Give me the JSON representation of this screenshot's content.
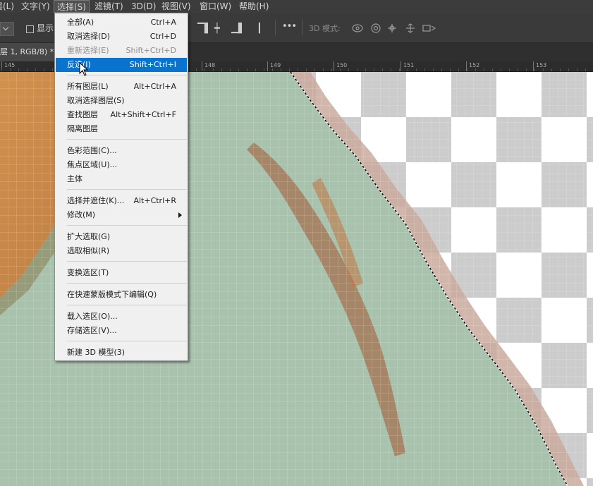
{
  "menubar": {
    "items": [
      {
        "label": "层(L)"
      },
      {
        "label": "文字(Y)"
      },
      {
        "label": "选择(S)"
      },
      {
        "label": "滤镜(T)"
      },
      {
        "label": "3D(D)"
      },
      {
        "label": "视图(V)"
      },
      {
        "label": "窗口(W)"
      },
      {
        "label": "帮助(H)"
      }
    ]
  },
  "options": {
    "show_label": "显示",
    "mode_3d_label": "3D 模式:",
    "more_label": "•••"
  },
  "document": {
    "tab_title": "层 1, RGB/8) *"
  },
  "ruler": {
    "labels": [
      "145",
      "148",
      "149",
      "150",
      "151",
      "152",
      "153"
    ]
  },
  "select_menu": {
    "items": [
      {
        "label": "全部(A)",
        "shortcut": "Ctrl+A",
        "state": "normal"
      },
      {
        "label": "取消选择(D)",
        "shortcut": "Ctrl+D",
        "state": "normal"
      },
      {
        "label": "重新选择(E)",
        "shortcut": "Shift+Ctrl+D",
        "state": "disabled"
      },
      {
        "label": "反选(I)",
        "shortcut": "Shift+Ctrl+I",
        "state": "highlighted"
      },
      {
        "label": "所有图层(L)",
        "shortcut": "Alt+Ctrl+A",
        "state": "normal"
      },
      {
        "label": "取消选择图层(S)",
        "shortcut": "",
        "state": "normal"
      },
      {
        "label": "查找图层",
        "shortcut": "Alt+Shift+Ctrl+F",
        "state": "normal"
      },
      {
        "label": "隔离图层",
        "shortcut": "",
        "state": "normal"
      },
      {
        "label": "色彩范围(C)...",
        "shortcut": "",
        "state": "normal"
      },
      {
        "label": "焦点区域(U)...",
        "shortcut": "",
        "state": "normal"
      },
      {
        "label": "主体",
        "shortcut": "",
        "state": "normal"
      },
      {
        "label": "选择并遮住(K)...",
        "shortcut": "Alt+Ctrl+R",
        "state": "normal"
      },
      {
        "label": "修改(M)",
        "shortcut": "",
        "state": "submenu"
      },
      {
        "label": "扩大选取(G)",
        "shortcut": "",
        "state": "normal"
      },
      {
        "label": "选取相似(R)",
        "shortcut": "",
        "state": "normal"
      },
      {
        "label": "变换选区(T)",
        "shortcut": "",
        "state": "normal"
      },
      {
        "label": "在快速蒙版模式下编辑(Q)",
        "shortcut": "",
        "state": "normal"
      },
      {
        "label": "载入选区(O)...",
        "shortcut": "",
        "state": "normal"
      },
      {
        "label": "存储选区(V)...",
        "shortcut": "",
        "state": "normal"
      },
      {
        "label": "新建 3D 模型(3)",
        "shortcut": "",
        "state": "normal"
      }
    ]
  },
  "colors": {
    "accent": "#0a73d0",
    "canvas_green": "#a9c3ae",
    "canvas_orange": "#c9864a",
    "stroke_brown": "#a2714e",
    "checker_gray": "#cccccc"
  }
}
